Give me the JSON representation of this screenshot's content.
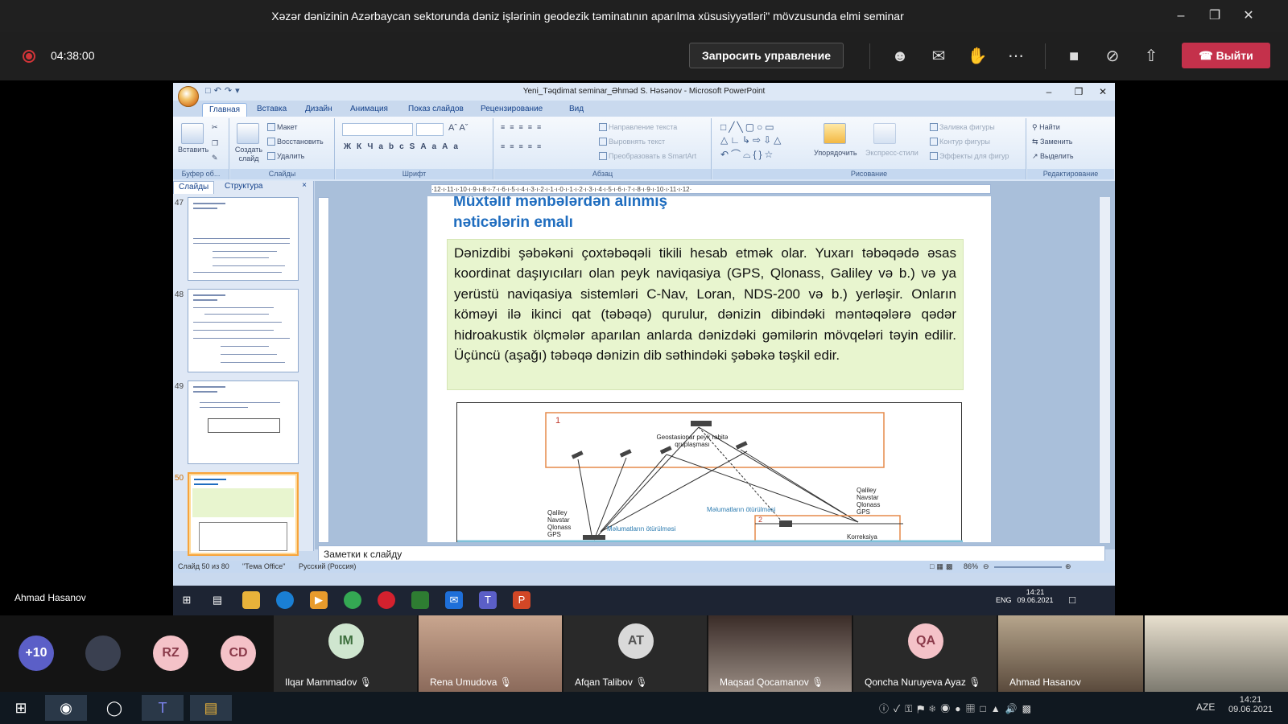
{
  "teams": {
    "window_title": "Xəzər dənizinin Azərbaycan sektorunda dəniz işlərinin geodezik təminatının aparılma xüsusiyyətləri\" mövzusunda elmi seminar",
    "timer": "04:38:00",
    "request_control": "Запросить управление",
    "leave": "Выйти",
    "presenter": "Ahmad Hasanov"
  },
  "ppt": {
    "title": "Yeni_Təqdimat seminar_Əhməd S. Həsənov - Microsoft PowerPoint",
    "tabs": [
      "Главная",
      "Вставка",
      "Дизайн",
      "Анимация",
      "Показ слайдов",
      "Рецензирование",
      "Вид"
    ],
    "groups": {
      "clipboard": "Буфер об...",
      "slides": "Слайды",
      "font": "Шрифт",
      "paragraph": "Абзац",
      "drawing": "Рисование",
      "editing": "Редактирование"
    },
    "clipboard": {
      "paste": "Вставить"
    },
    "slides_group": {
      "new_slide": "Создать слайд",
      "layout": "Макет",
      "reset": "Восстановить",
      "delete": "Удалить"
    },
    "paragraph": {
      "text_direction": "Направление текста",
      "align_text": "Выровнять текст",
      "smartart": "Преобразовать в SmartArt"
    },
    "drawing": {
      "arrange": "Упорядочить",
      "quick_styles": "Экспресс-стили",
      "fill": "Заливка фигуры",
      "outline": "Контур фигуры",
      "effects": "Эффекты для фигур"
    },
    "editing": {
      "find": "Найти",
      "replace": "Заменить",
      "select": "Выделить"
    },
    "pane_tabs": [
      "Слайды",
      "Структура"
    ],
    "thumbnails": [
      {
        "num": "47",
        "selected": false
      },
      {
        "num": "48",
        "selected": false
      },
      {
        "num": "49",
        "selected": false
      },
      {
        "num": "50",
        "selected": true
      }
    ],
    "ruler_labels": "·12·ı·11·ı·10·ı·9·ı·8·ı·7·ı·6·ı·5·ı·4·ı·3·ı·2·ı·1·ı·0·ı·1·ı·2·ı·3·ı·4·ı·5·ı·6·ı·7·ı·8·ı·9·ı·10·ı·11·ı·12·",
    "slide": {
      "title_line1": "Müxtəlif mənbələrdən alınmış",
      "title_line2": "nəticələrin emalı",
      "body": "Dənizdibi şəbəkəni çoxtəbəqəli  tikili hesab etmək olar. Yuxarı təbəqədə əsas koordinat  daşıyıcıları olan peyk naviqasiya (GPS, Qlonass, Galiley və b.) və ya yerüstü naviqasiya sistemləri C-Nav, Loran, NDS-200 və b.) yerləşir. Onların köməyi ilə ikinci qat (təbəqə) qurulur, dənizin dibindəki məntəqələrə qədər hidroakustik ölçmələr aparılan anlarda dənizdəki gəmilərin mövqeləri təyin edilir. Üçüncü (aşağı) təbəqə dənizin dib səthindəki şəbəkə təşkil edir.",
      "diagram": {
        "label1": "1",
        "label2": "2",
        "geo": "Geostasionar peyk rabitə",
        "geo2": "qruplaşması",
        "left_sats": [
          "Qaliley",
          "Navstar",
          "Qlonass",
          "GPS"
        ],
        "right_sats": [
          "Qaliley",
          "Navstar",
          "Qlonass",
          "GPS"
        ],
        "transfer1": "Məlumatların ötürülməsi",
        "transfer2": "Məlumatların ötürülməsi",
        "corr": "Korreksiya"
      }
    },
    "notes": "Заметки к слайду",
    "status": {
      "slide": "Слайд 50 из 80",
      "theme": "\"Тема Office\"",
      "lang": "Русский (Россия)",
      "zoom": "86%"
    }
  },
  "shared_taskbar": {
    "lang": "ENG",
    "time": "14:21",
    "date": "09.06.2021"
  },
  "participants": {
    "overflow": "+10",
    "avatars": [
      {
        "initials": "RZ",
        "color": "#f4c2c8"
      },
      {
        "initials": "CD",
        "color": "#f4c2c8"
      }
    ],
    "tiles": [
      {
        "initials": "IM",
        "name": "Ilqar Mammadov",
        "color": "#cfe6cf",
        "video": false
      },
      {
        "initials": "",
        "name": "Rena Umudova",
        "video": true
      },
      {
        "initials": "AT",
        "name": "Afqan Talibov",
        "color": "#d9d9d9",
        "video": false
      },
      {
        "initials": "",
        "name": "Maqsad Qocamanov",
        "video": true
      },
      {
        "initials": "QA",
        "name": "Qoncha Nuruyeva Ayaz",
        "color": "#f4c2c8",
        "video": false
      },
      {
        "initials": "",
        "name": "Ahmad Hasanov",
        "video": true
      }
    ]
  },
  "local_taskbar": {
    "lang": "AZE",
    "time": "14:21",
    "date": "09.06.2021"
  }
}
